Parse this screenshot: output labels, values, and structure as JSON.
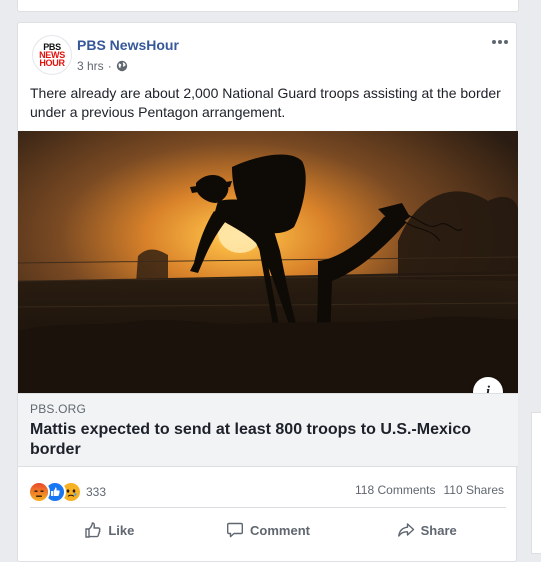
{
  "post": {
    "page_name": "PBS NewsHour",
    "timestamp": "3 hrs",
    "privacy_separator": "·",
    "privacy_icon": "globe-icon",
    "logo": {
      "line1": "PBS",
      "line2": "NEWS",
      "line3": "HOUR"
    },
    "text": "There already are about 2,000 National Guard troops assisting at the border under a previous Pentagon arrangement."
  },
  "link": {
    "domain": "PBS.ORG",
    "title": "Mattis expected to send at least 800 troops to U.S.-Mexico border",
    "info_label": "i"
  },
  "stats": {
    "reaction_icons": [
      "angry-icon",
      "like-icon",
      "sad-icon"
    ],
    "reaction_count": "333",
    "comments": "118 Comments",
    "shares": "110 Shares"
  },
  "actions": {
    "like": "Like",
    "comment": "Comment",
    "share": "Share"
  },
  "colors": {
    "page_name": "#365899",
    "angry": "#f05a2a",
    "like": "#1877f2",
    "sad": "#f7b125",
    "sunset": "#f7a12a"
  }
}
